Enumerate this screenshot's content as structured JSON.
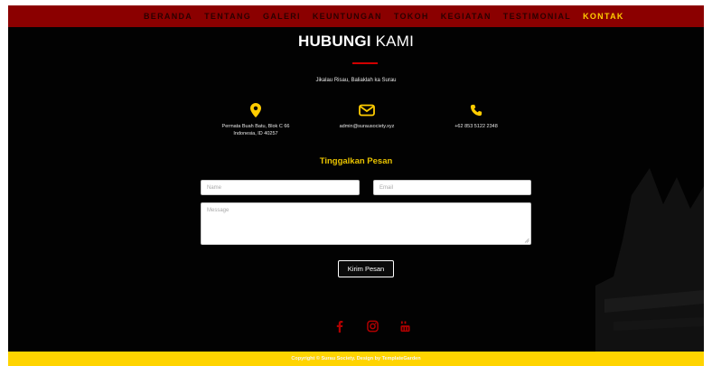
{
  "nav": {
    "items": [
      {
        "label": "BERANDA",
        "active": false
      },
      {
        "label": "TENTANG",
        "active": false
      },
      {
        "label": "GALERI",
        "active": false
      },
      {
        "label": "KEUNTUNGAN",
        "active": false
      },
      {
        "label": "TOKOH",
        "active": false
      },
      {
        "label": "KEGIATAN",
        "active": false
      },
      {
        "label": "TESTIMONIAL",
        "active": false
      },
      {
        "label": "KONTAK",
        "active": true
      }
    ]
  },
  "section": {
    "title_bold": "HUBUNGI",
    "title_light": "KAMI",
    "subtitle": "Jikalau Risau, Baliaklah ka Surau"
  },
  "contacts": {
    "address": {
      "icon": "map-pin-icon",
      "line1": "Permata Buah Batu, Blok C 66",
      "line2": "Indonesia, ID 40257"
    },
    "email": {
      "icon": "envelope-icon",
      "text": "admin@surausociety.xyz"
    },
    "phone": {
      "icon": "phone-icon",
      "text": "+62 853 5122 2348"
    }
  },
  "form": {
    "title": "Tinggalkan Pesan",
    "name_placeholder": "Name",
    "email_placeholder": "Email",
    "message_placeholder": "Message",
    "submit_label": "Kirim Pesan"
  },
  "social": [
    "facebook-icon",
    "instagram-icon",
    "youtube-icon"
  ],
  "footer": {
    "text": "Copyright © Surau Society. Design by TemplateGarden"
  },
  "colors": {
    "navbar": "#8b0000",
    "accent": "#ffcc00",
    "background": "#020202",
    "footer": "#ffd400",
    "social": "#b00000"
  }
}
